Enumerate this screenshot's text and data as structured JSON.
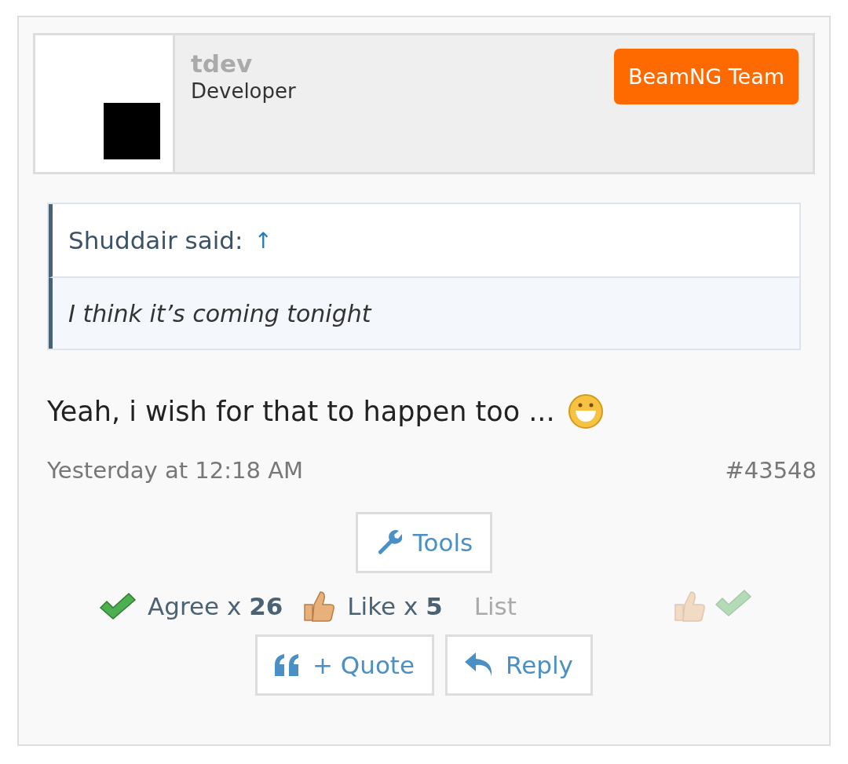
{
  "author": {
    "name": "tdev",
    "title": "Developer",
    "badge": "BeamNG Team"
  },
  "quote": {
    "attribution": "Shuddair said:",
    "link": "↑",
    "text": "I think it’s coming tonight"
  },
  "message": {
    "text": "Yeah, i wish for that to happen too ..."
  },
  "meta": {
    "date": "Yesterday at 12:18 AM",
    "post_number": "#43548"
  },
  "tools_button": "Tools",
  "reactions": [
    {
      "kind": "agree",
      "text": "Agree x **26**"
    },
    {
      "kind": "like",
      "text": "Like x **5**"
    }
  ],
  "list_link": "List",
  "rate_buttons": [
    {
      "kind": "like",
      "selected": false
    },
    {
      "kind": "agree",
      "selected": false
    }
  ],
  "actions": [
    {
      "kind": "quote",
      "label": "+ Quote"
    },
    {
      "kind": "reply",
      "label": "Reply"
    }
  ]
}
